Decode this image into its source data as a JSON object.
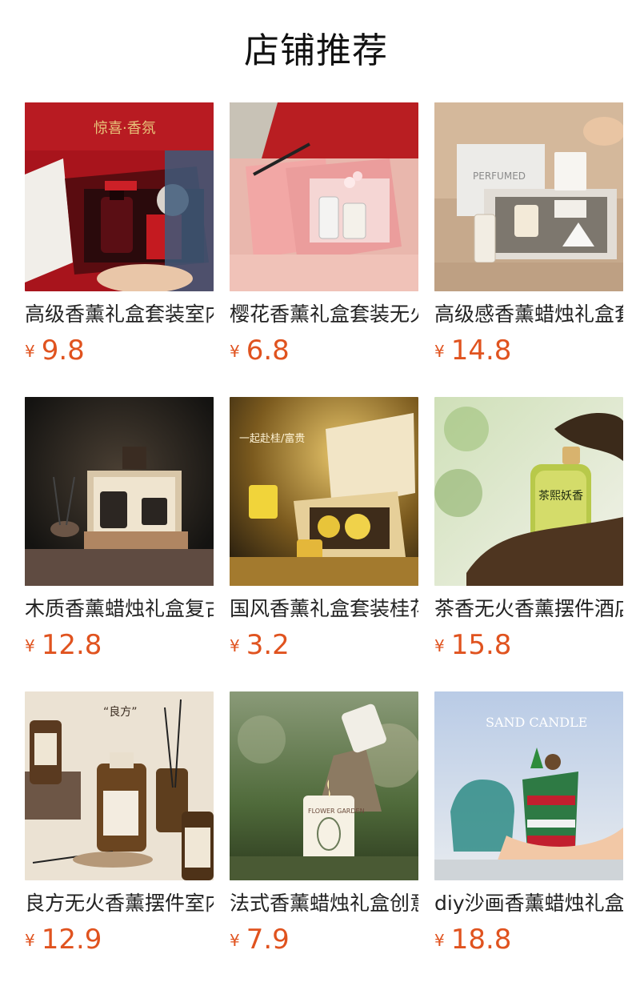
{
  "page": {
    "title": "店铺推荐"
  },
  "colors": {
    "price": "#e0531f",
    "text": "#222222",
    "background": "#ffffff"
  },
  "currency": "¥",
  "products": [
    {
      "name": "高级香薰礼盒套装室内",
      "price": "9.8",
      "image_icon": "red-gift-box-perfume-image",
      "image_text": "惊喜·香氛"
    },
    {
      "name": "樱花香薰礼盒套装无火",
      "price": "6.8",
      "image_icon": "pink-gift-box-image"
    },
    {
      "name": "高级感香薰蜡烛礼盒套",
      "price": "14.8",
      "image_icon": "perfumed-candle-set-image",
      "image_text": "PERFUMED"
    },
    {
      "name": "木质香薰蜡烛礼盒复古",
      "price": "12.8",
      "image_icon": "wooden-candle-box-image"
    },
    {
      "name": "国风香薰礼盒套装桂花",
      "price": "3.2",
      "image_icon": "osmanthus-gift-box-image",
      "image_text": "一起赴桂/富贵"
    },
    {
      "name": "茶香无火香薰摆件酒店",
      "price": "15.8",
      "image_icon": "tea-aroma-bottle-image",
      "image_text": "茶熙妖香"
    },
    {
      "name": "良方无火香薰摆件室内",
      "price": "12.9",
      "image_icon": "reed-diffuser-bottles-image",
      "image_text": "“良方”"
    },
    {
      "name": "法式香薰蜡烛礼盒创意",
      "price": "7.9",
      "image_icon": "flower-garden-candle-image",
      "image_text": "FLOWER GARDEN"
    },
    {
      "name": "diy沙画香薰蜡烛礼盒",
      "price": "18.8",
      "image_icon": "sand-candle-image",
      "image_text": "SAND CANDLE"
    }
  ]
}
